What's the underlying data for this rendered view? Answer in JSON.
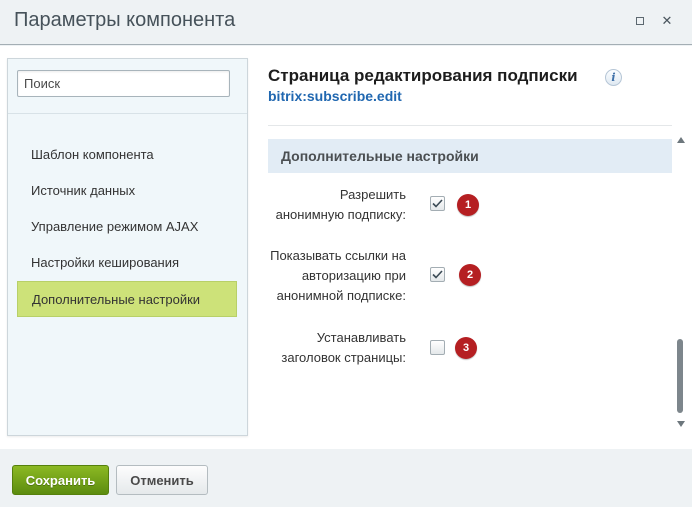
{
  "window": {
    "title": "Параметры компонента",
    "maximize_icon": "maximize-icon",
    "close_icon": "close-icon",
    "close_glyph": "✕"
  },
  "sidebar": {
    "search": {
      "placeholder": "Поиск",
      "value": ""
    },
    "items": [
      {
        "label": "Шаблон компонента",
        "active": false
      },
      {
        "label": "Источник данных",
        "active": false
      },
      {
        "label": "Управление режимом AJAX",
        "active": false
      },
      {
        "label": "Настройки кеширования",
        "active": false
      },
      {
        "label": "Дополнительные настройки",
        "active": true
      }
    ]
  },
  "main": {
    "title": "Страница редактирования подписки",
    "info_glyph": "i",
    "component_id": "bitrix:subscribe.edit",
    "section_title": "Дополнительные настройки",
    "options": [
      {
        "label_lines": [
          "Разрешить",
          "анонимную подписку:"
        ],
        "checked": true,
        "badge": "1"
      },
      {
        "label_lines": [
          "Показывать ссылки на",
          "авторизацию при",
          "анонимной подписке:"
        ],
        "checked": true,
        "badge": "2"
      },
      {
        "label_lines": [
          "Устанавливать",
          "заголовок страницы:"
        ],
        "checked": false,
        "badge": "3"
      }
    ]
  },
  "footer": {
    "save_label": "Сохранить",
    "cancel_label": "Отменить"
  },
  "colors": {
    "accent_active": "#cde279",
    "save_button": "#6f9f17",
    "badge": "#b51f22",
    "link": "#2067b0"
  }
}
